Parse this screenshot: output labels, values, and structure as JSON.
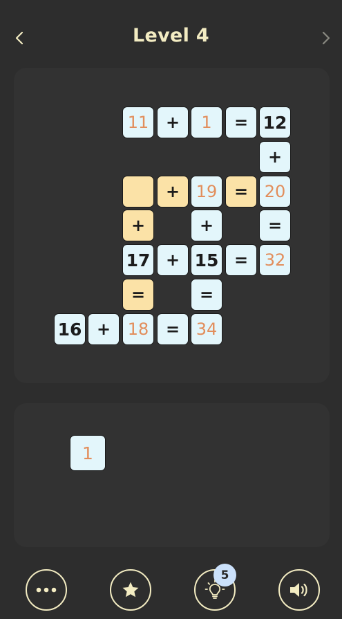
{
  "header": {
    "title": "Level 4",
    "prev_icon": "chevron-left-icon",
    "next_icon": "chevron-right-icon",
    "title_color": "#f3ecc2"
  },
  "board": {
    "tiles": [
      {
        "text": "11",
        "kind": "value",
        "style": "orange"
      },
      {
        "text": "+",
        "kind": "op",
        "style": "normal"
      },
      {
        "text": "1",
        "kind": "value",
        "style": "orange"
      },
      {
        "text": "=",
        "kind": "op",
        "style": "normal"
      },
      {
        "text": "12",
        "kind": "value",
        "style": "normal"
      },
      {
        "text": "+",
        "kind": "op",
        "style": "normal"
      },
      {
        "text": "",
        "kind": "empty",
        "style": "yellow"
      },
      {
        "text": "+",
        "kind": "op",
        "style": "yellow"
      },
      {
        "text": "19",
        "kind": "value",
        "style": "orange"
      },
      {
        "text": "=",
        "kind": "op",
        "style": "yellow"
      },
      {
        "text": "20",
        "kind": "value",
        "style": "orange"
      },
      {
        "text": "+",
        "kind": "op",
        "style": "yellow"
      },
      {
        "text": "+",
        "kind": "op",
        "style": "normal"
      },
      {
        "text": "=",
        "kind": "op",
        "style": "normal"
      },
      {
        "text": "17",
        "kind": "value",
        "style": "normal"
      },
      {
        "text": "+",
        "kind": "op",
        "style": "normal"
      },
      {
        "text": "15",
        "kind": "value",
        "style": "normal"
      },
      {
        "text": "=",
        "kind": "op",
        "style": "normal"
      },
      {
        "text": "32",
        "kind": "value",
        "style": "orange"
      },
      {
        "text": "=",
        "kind": "op",
        "style": "yellow"
      },
      {
        "text": "=",
        "kind": "op",
        "style": "normal"
      },
      {
        "text": "16",
        "kind": "value",
        "style": "normal"
      },
      {
        "text": "+",
        "kind": "op",
        "style": "normal"
      },
      {
        "text": "18",
        "kind": "value",
        "style": "orange"
      },
      {
        "text": "=",
        "kind": "op",
        "style": "normal"
      },
      {
        "text": "34",
        "kind": "value",
        "style": "orange"
      }
    ]
  },
  "tray": {
    "tiles": [
      {
        "text": "1"
      }
    ]
  },
  "toolbar": {
    "menu_icon": "more-dots-icon",
    "favorite_icon": "star-icon",
    "hint_icon": "lightbulb-icon",
    "hint_count": "5",
    "sound_icon": "speaker-icon"
  },
  "colors": {
    "background": "#2d2d2d",
    "panel": "#323232",
    "tile": "#e3f6fb",
    "tile_highlight": "#fbe2a7",
    "number_accent": "#e28e5c",
    "badge": "#cbe1fb"
  }
}
